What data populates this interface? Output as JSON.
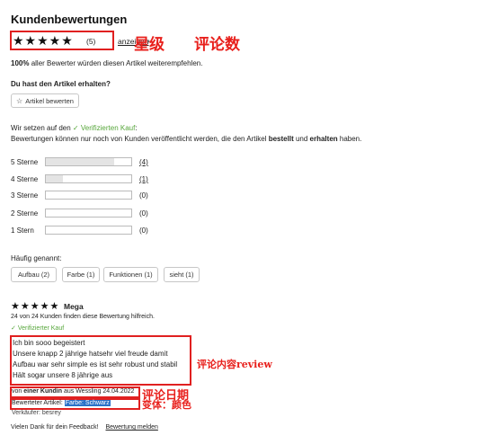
{
  "header": {
    "title": "Kundenbewertungen",
    "stars": "★★★★★",
    "count": "(5)",
    "show_link": "anzeigen",
    "chevron": "›"
  },
  "annotations": {
    "rating": "星级",
    "review_count": "评论数",
    "review_content": "评论内容review",
    "review_date": "评论日期",
    "variant": "变体：颜色"
  },
  "recommend": {
    "pct": "100%",
    "text": " aller Bewerter würden diesen Artikel weiterempfehlen."
  },
  "received": {
    "question": "Du hast den Artikel erhalten?",
    "button_label": "Artikel bewerten"
  },
  "verified_note": {
    "line1_prefix": "Wir setzen auf den ",
    "line1_link": "Verifizierten Kauf",
    "line1_suffix": ":",
    "line2_a": "Bewertungen können nur noch von Kunden veröffentlicht werden, die den Artikel ",
    "line2_b1": "bestellt",
    "line2_mid": " und ",
    "line2_b2": "erhalten",
    "line2_end": " haben."
  },
  "distribution": [
    {
      "label": "5 Sterne",
      "count": "(4)",
      "fraction": 0.8,
      "linked": true
    },
    {
      "label": "4 Sterne",
      "count": "(1)",
      "fraction": 0.2,
      "linked": true
    },
    {
      "label": "3 Sterne",
      "count": "(0)",
      "fraction": 0.0,
      "linked": false
    },
    {
      "label": "2 Sterne",
      "count": "(0)",
      "fraction": 0.0,
      "linked": false
    },
    {
      "label": "1 Stern",
      "count": "(0)",
      "fraction": 0.0,
      "linked": false
    }
  ],
  "frequent": {
    "label": "Häufig genannt:",
    "chips": [
      "Aufbau (2)",
      "Farbe (1)",
      "Funktionen (1)",
      "sieht (1)"
    ]
  },
  "review": {
    "stars": "★★★★★",
    "title": "Mega",
    "helpful": "24 von 24 Kunden finden diese Bewertung hilfreich.",
    "verified": "Verifizierter Kauf",
    "body": [
      "Ich bin sooo begeistert",
      "Unsere knapp 2 jährige hatsehr viel freude damit",
      "Aufbau war sehr simple es ist sehr robust und stabil",
      "Hält sogar unsere 8 jährige aus"
    ],
    "meta_prefix": "von ",
    "meta_author": "einer Kundin",
    "meta_suffix": " aus Wessling 24.04.2022",
    "variant_label": "Bewerteter Artikel: ",
    "variant_value": "Farbe: Schwarz",
    "seller": "Verkäufer: besrey",
    "thanks": "Vielen Dank für dein Feedback!",
    "report": "Bewertung melden"
  },
  "colors": {
    "accent_red": "#e02020",
    "green": "#56a63a",
    "highlight": "#2a72c8"
  }
}
